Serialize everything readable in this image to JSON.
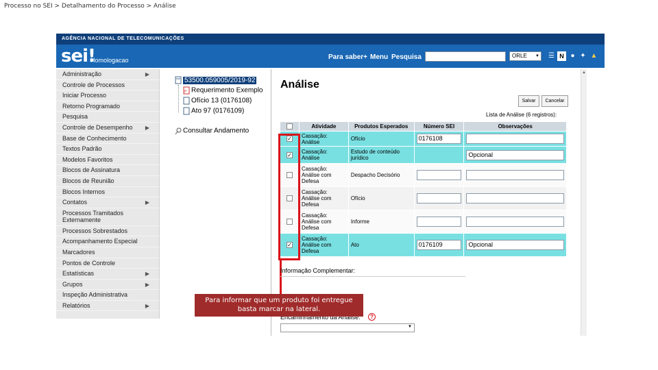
{
  "breadcrumb": "Processo no SEI > Detalhamento do Processo > Análise",
  "header": {
    "agency": "AGÊNCIA NACIONAL DE TELECOMUNICAÇÕES",
    "logo": "sei!",
    "environment": "Homologacao",
    "links": [
      "Para saber+",
      "Menu",
      "Pesquisa"
    ],
    "unit_selected": "ORLE",
    "icons": [
      "list-icon",
      "n-icon",
      "user-icon",
      "tools-icon",
      "exit-icon"
    ],
    "brand_color": "#1967b5"
  },
  "sidebar": {
    "items": [
      {
        "label": "Administração",
        "has_submenu": true
      },
      {
        "label": "Controle de Processos",
        "has_submenu": false
      },
      {
        "label": "Iniciar Processo",
        "has_submenu": false
      },
      {
        "label": "Retorno Programado",
        "has_submenu": false
      },
      {
        "label": "Pesquisa",
        "has_submenu": false
      },
      {
        "label": "Controle de Desempenho",
        "has_submenu": true
      },
      {
        "label": "Base de Conhecimento",
        "has_submenu": false
      },
      {
        "label": "Textos Padrão",
        "has_submenu": false
      },
      {
        "label": "Modelos Favoritos",
        "has_submenu": false
      },
      {
        "label": "Blocos de Assinatura",
        "has_submenu": false
      },
      {
        "label": "Blocos de Reunião",
        "has_submenu": false
      },
      {
        "label": "Blocos Internos",
        "has_submenu": false
      },
      {
        "label": "Contatos",
        "has_submenu": true
      },
      {
        "label": "Processos Tramitados Externamente",
        "has_submenu": false
      },
      {
        "label": "Processos Sobrestados",
        "has_submenu": false
      },
      {
        "label": "Acompanhamento Especial",
        "has_submenu": false
      },
      {
        "label": "Marcadores",
        "has_submenu": false
      },
      {
        "label": "Pontos de Controle",
        "has_submenu": false
      },
      {
        "label": "Estatísticas",
        "has_submenu": true
      },
      {
        "label": "Grupos",
        "has_submenu": true
      },
      {
        "label": "Inspeção Administrativa",
        "has_submenu": false
      },
      {
        "label": "Relatórios",
        "has_submenu": true
      }
    ]
  },
  "tree": {
    "root": "53500.059005/2019-92",
    "children": [
      "Requerimento Exemplo",
      "Ofício 13 (0176108)",
      "Ato 97 (0176109)"
    ],
    "consult": "Consultar Andamento"
  },
  "main": {
    "title": "Análise",
    "save_label": "Salvar",
    "cancel_label": "Cancelar",
    "caption": "Lista de Análise (6 registros):",
    "columns": [
      "Atividade",
      "Produtos Esperados",
      "Número SEI",
      "Observações"
    ],
    "rows": [
      {
        "checked": true,
        "activity": "Cassação: Análise",
        "product": "Ofício",
        "sei": "0176108",
        "obs": ""
      },
      {
        "checked": true,
        "activity": "Cassação: Análise",
        "product": "Estudo de conteúdo jurídico",
        "sei": "",
        "obs": "Opcional"
      },
      {
        "checked": false,
        "activity": "Cassação: Análise com Defesa",
        "product": "Despacho Decisório",
        "sei": "",
        "obs": ""
      },
      {
        "checked": false,
        "activity": "Cassação: Análise com Defesa",
        "product": "Ofício",
        "sei": "",
        "obs": ""
      },
      {
        "checked": false,
        "activity": "Cassação: Análise com Defesa",
        "product": "Informe",
        "sei": "",
        "obs": ""
      },
      {
        "checked": true,
        "activity": "Cassação: Análise com Defesa",
        "product": "Ato",
        "sei": "0176109",
        "obs": "Opcional"
      }
    ],
    "info_label": "Informação Complementar:",
    "encaminhamento_label": "Encaminhamento da Análise:",
    "highlight_color": "#79e0e2"
  },
  "tooltip": {
    "text": "Para informar que um produto foi entregue basta marcar na lateral.",
    "color": "#a02b2b"
  }
}
